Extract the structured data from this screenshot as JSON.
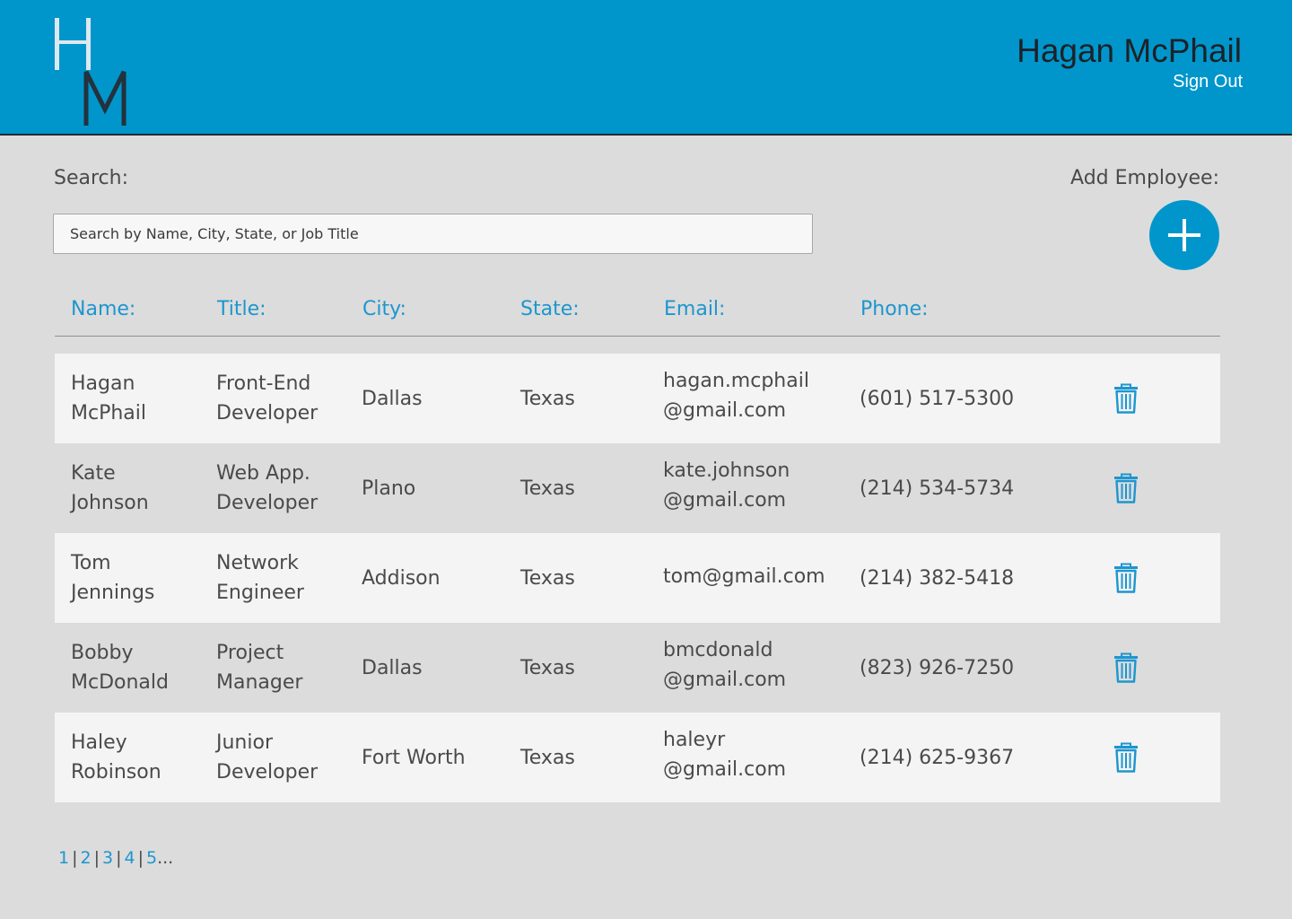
{
  "header": {
    "logo_letters": [
      "H",
      "M"
    ],
    "user_name": "Hagan McPhail",
    "sign_out_label": "Sign Out"
  },
  "search": {
    "label": "Search:",
    "placeholder": "Search by Name, City, State, or Job Title"
  },
  "add_employee": {
    "label": "Add Employee:",
    "icon": "plus-icon"
  },
  "table": {
    "columns": [
      "Name:",
      "Title:",
      "City:",
      "State:",
      "Email:",
      "Phone:"
    ],
    "rows": [
      {
        "name": [
          "Hagan",
          "McPhail"
        ],
        "title": [
          "Front-End",
          "Developer"
        ],
        "city": "Dallas",
        "state": "Texas",
        "email": [
          "hagan.mcphail",
          "@gmail.com"
        ],
        "phone": "(601) 517-5300"
      },
      {
        "name": [
          "Kate",
          "Johnson"
        ],
        "title": [
          "Web App.",
          "Developer"
        ],
        "city": "Plano",
        "state": "Texas",
        "email": [
          "kate.johnson",
          "@gmail.com"
        ],
        "phone": "(214) 534-5734"
      },
      {
        "name": [
          "Tom",
          "Jennings"
        ],
        "title": [
          "Network",
          "Engineer"
        ],
        "city": "Addison",
        "state": "Texas",
        "email": [
          "tom@gmail.com",
          ""
        ],
        "phone": "(214) 382-5418"
      },
      {
        "name": [
          "Bobby",
          "McDonald"
        ],
        "title": [
          "Project",
          "Manager"
        ],
        "city": "Dallas",
        "state": "Texas",
        "email": [
          "bmcdonald",
          "@gmail.com"
        ],
        "phone": "(823) 926-7250"
      },
      {
        "name": [
          "Haley",
          "Robinson"
        ],
        "title": [
          "Junior",
          "Developer"
        ],
        "city": "Fort Worth",
        "state": "Texas",
        "email": [
          "haleyr",
          "@gmail.com"
        ],
        "phone": "(214) 625-9367"
      }
    ],
    "row_action_icon": "trash-icon"
  },
  "pagination": {
    "pages": [
      "1",
      "2",
      "3",
      "4",
      "5"
    ],
    "separator": "|",
    "more": "..."
  },
  "colors": {
    "header_bg": "#0096cb",
    "accent": "#1d96cf",
    "page_bg": "#dcdcdc",
    "row_light": "#f4f4f4",
    "text": "#4a4a4a",
    "dark_text": "#1d2228"
  }
}
